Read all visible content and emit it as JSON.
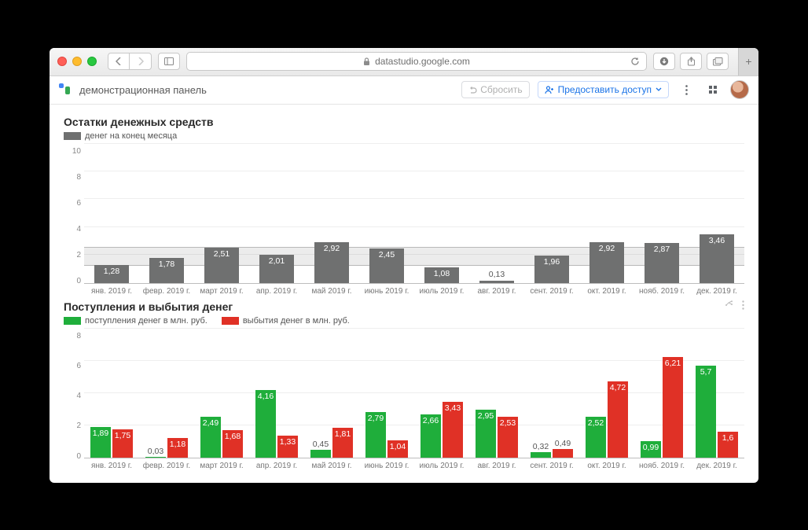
{
  "browser": {
    "url_host": "datastudio.google.com"
  },
  "appbar": {
    "title": "демонстрационная панель",
    "reset_label": "Сбросить",
    "share_label": "Предоставить доступ"
  },
  "chart_data": [
    {
      "type": "bar",
      "title": "Остатки денежных средств",
      "legend": [
        "денег на конец месяца"
      ],
      "categories": [
        "янв. 2019 г.",
        "февр. 2019 г.",
        "март 2019 г.",
        "апр. 2019 г.",
        "май 2019 г.",
        "июнь 2019 г.",
        "июль 2019 г.",
        "авг. 2019 г.",
        "сент. 2019 г.",
        "окт. 2019 г.",
        "нояб. 2019 г.",
        "дек. 2019 г."
      ],
      "values": [
        1.28,
        1.78,
        2.51,
        2.01,
        2.92,
        2.45,
        1.08,
        0.13,
        1.96,
        2.92,
        2.87,
        3.46
      ],
      "display_values": [
        "1,28",
        "1,78",
        "2,51",
        "2,01",
        "2,92",
        "2,45",
        "1,08",
        "0,13",
        "1,96",
        "2,92",
        "2,87",
        "3,46"
      ],
      "ylim": [
        0,
        10
      ],
      "yticks": [
        0,
        2,
        4,
        6,
        8,
        10
      ],
      "band": [
        1.2,
        2.6
      ],
      "xlabel": "",
      "ylabel": ""
    },
    {
      "type": "bar",
      "title": "Поступления и выбытия денег",
      "legend": [
        "поступления денег в млн. руб.",
        "выбытия денег в млн. руб."
      ],
      "categories": [
        "янв. 2019 г.",
        "февр. 2019 г.",
        "март 2019 г.",
        "апр. 2019 г.",
        "май 2019 г.",
        "июнь 2019 г.",
        "июль 2019 г.",
        "авг. 2019 г.",
        "сент. 2019 г.",
        "окт. 2019 г.",
        "нояб. 2019 г.",
        "дек. 2019 г."
      ],
      "series": [
        {
          "name": "поступления денег в млн. руб.",
          "color": "#1fae3b",
          "values": [
            1.89,
            0.03,
            2.49,
            4.16,
            0.45,
            2.79,
            2.66,
            2.95,
            0.32,
            2.52,
            0.99,
            5.7
          ],
          "display_values": [
            "1,89",
            "0,03",
            "2,49",
            "4,16",
            "0,45",
            "2,79",
            "2,66",
            "2,95",
            "0,32",
            "2,52",
            "0,99",
            "5,7"
          ]
        },
        {
          "name": "выбытия денег в млн. руб.",
          "color": "#e03126",
          "values": [
            1.75,
            1.18,
            1.68,
            1.33,
            1.81,
            1.04,
            3.43,
            2.53,
            0.49,
            4.72,
            6.21,
            1.6
          ],
          "display_values": [
            "1,75",
            "1,18",
            "1,68",
            "1,33",
            "1,81",
            "1,04",
            "3,43",
            "2,53",
            "0,49",
            "4,72",
            "6,21",
            "1,6"
          ]
        }
      ],
      "ylim": [
        0,
        8
      ],
      "yticks": [
        0,
        2,
        4,
        6,
        8
      ],
      "xlabel": "",
      "ylabel": ""
    }
  ]
}
